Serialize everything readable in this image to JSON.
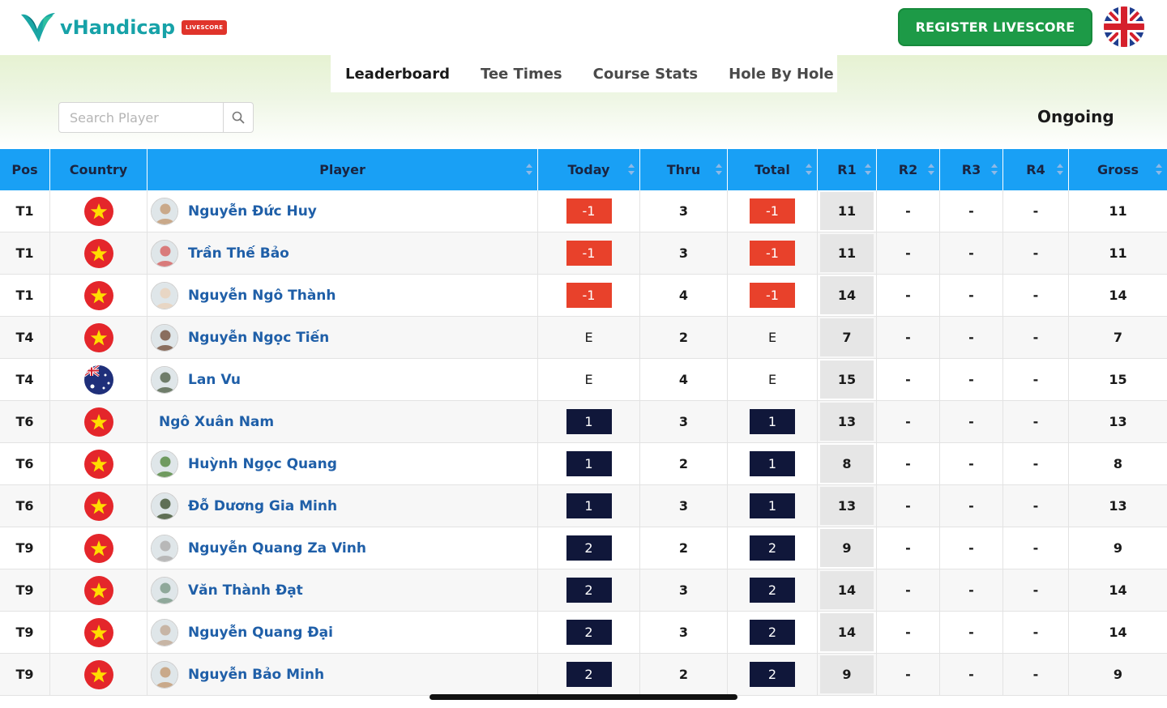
{
  "header": {
    "logo_text": "vHandicap",
    "logo_badge": "LIVESCORE",
    "register_label": "REGISTER LIVESCORE",
    "language_flag": "uk-flag-icon"
  },
  "tabs": [
    {
      "label": "Leaderboard",
      "active": true
    },
    {
      "label": "Tee Times",
      "active": false
    },
    {
      "label": "Course Stats",
      "active": false
    },
    {
      "label": "Hole By Hole",
      "active": false
    }
  ],
  "search": {
    "placeholder": "Search Player",
    "value": "",
    "icon": "search-icon"
  },
  "status": "Ongoing",
  "colors": {
    "header_bg": "#19a0f5",
    "under_par": "#e8412b",
    "over_par": "#10173a",
    "register": "#1d9a47",
    "player_link": "#1f5fa8"
  },
  "table": {
    "columns": [
      "Pos",
      "Country",
      "Player",
      "Today",
      "Thru",
      "Total",
      "R1",
      "R2",
      "R3",
      "R4",
      "Gross"
    ],
    "rows": [
      {
        "pos": "T1",
        "country": "vn",
        "player": "Nguyễn Đức Huy",
        "avatar": true,
        "today": "-1",
        "thru": "3",
        "total": "-1",
        "r1": "11",
        "r2": "-",
        "r3": "-",
        "r4": "-",
        "gross": "11"
      },
      {
        "pos": "T1",
        "country": "vn",
        "player": "Trần Thế Bảo",
        "avatar": true,
        "today": "-1",
        "thru": "3",
        "total": "-1",
        "r1": "11",
        "r2": "-",
        "r3": "-",
        "r4": "-",
        "gross": "11"
      },
      {
        "pos": "T1",
        "country": "vn",
        "player": "Nguyễn Ngô Thành",
        "avatar": true,
        "today": "-1",
        "thru": "4",
        "total": "-1",
        "r1": "14",
        "r2": "-",
        "r3": "-",
        "r4": "-",
        "gross": "14"
      },
      {
        "pos": "T4",
        "country": "vn",
        "player": "Nguyễn Ngọc Tiến",
        "avatar": true,
        "today": "E",
        "thru": "2",
        "total": "E",
        "r1": "7",
        "r2": "-",
        "r3": "-",
        "r4": "-",
        "gross": "7"
      },
      {
        "pos": "T4",
        "country": "au",
        "player": "Lan Vu",
        "avatar": true,
        "today": "E",
        "thru": "4",
        "total": "E",
        "r1": "15",
        "r2": "-",
        "r3": "-",
        "r4": "-",
        "gross": "15"
      },
      {
        "pos": "T6",
        "country": "vn",
        "player": "Ngô Xuân Nam",
        "avatar": false,
        "today": "1",
        "thru": "3",
        "total": "1",
        "r1": "13",
        "r2": "-",
        "r3": "-",
        "r4": "-",
        "gross": "13"
      },
      {
        "pos": "T6",
        "country": "vn",
        "player": "Huỳnh Ngọc Quang",
        "avatar": true,
        "today": "1",
        "thru": "2",
        "total": "1",
        "r1": "8",
        "r2": "-",
        "r3": "-",
        "r4": "-",
        "gross": "8"
      },
      {
        "pos": "T6",
        "country": "vn",
        "player": "Đỗ Dương Gia Minh",
        "avatar": true,
        "today": "1",
        "thru": "3",
        "total": "1",
        "r1": "13",
        "r2": "-",
        "r3": "-",
        "r4": "-",
        "gross": "13"
      },
      {
        "pos": "T9",
        "country": "vn",
        "player": "Nguyễn Quang Za Vinh",
        "avatar": true,
        "today": "2",
        "thru": "2",
        "total": "2",
        "r1": "9",
        "r2": "-",
        "r3": "-",
        "r4": "-",
        "gross": "9"
      },
      {
        "pos": "T9",
        "country": "vn",
        "player": "Văn Thành Đạt",
        "avatar": true,
        "today": "2",
        "thru": "3",
        "total": "2",
        "r1": "14",
        "r2": "-",
        "r3": "-",
        "r4": "-",
        "gross": "14"
      },
      {
        "pos": "T9",
        "country": "vn",
        "player": "Nguyễn Quang Đại",
        "avatar": true,
        "today": "2",
        "thru": "3",
        "total": "2",
        "r1": "14",
        "r2": "-",
        "r3": "-",
        "r4": "-",
        "gross": "14"
      },
      {
        "pos": "T9",
        "country": "vn",
        "player": "Nguyễn Bảo Minh",
        "avatar": true,
        "today": "2",
        "thru": "2",
        "total": "2",
        "r1": "9",
        "r2": "-",
        "r3": "-",
        "r4": "-",
        "gross": "9"
      }
    ]
  }
}
